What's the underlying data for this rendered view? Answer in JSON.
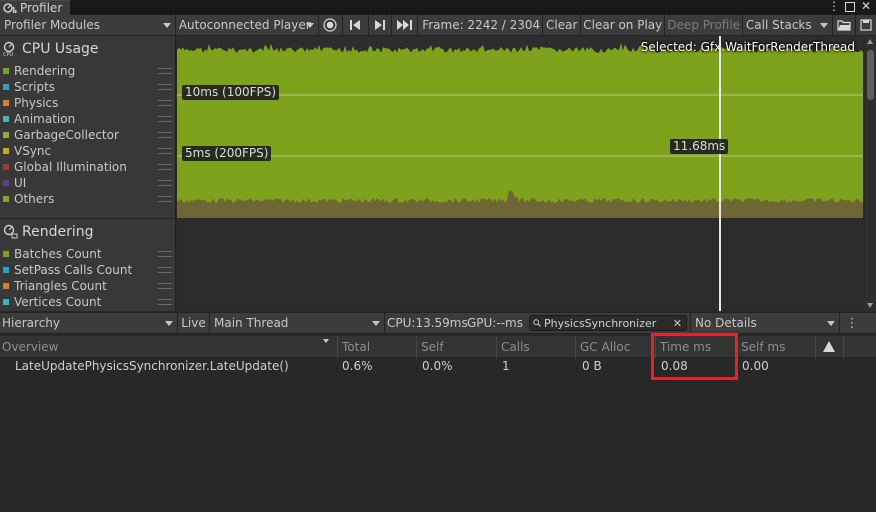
{
  "window": {
    "tab_title": "Profiler"
  },
  "toolbar": {
    "modules_label": "Profiler Modules",
    "target_label": "Autoconnected Player",
    "frame_label": "Frame: 2242 / 2304",
    "clear_label": "Clear",
    "clear_on_play_label": "Clear on Play",
    "deep_profile_label": "Deep Profile",
    "call_stacks_label": "Call Stacks"
  },
  "modules": {
    "cpu": {
      "title": "CPU Usage",
      "legend": [
        {
          "label": "Rendering",
          "color": "#78a31c"
        },
        {
          "label": "Scripts",
          "color": "#2aa3c6"
        },
        {
          "label": "Physics",
          "color": "#d8812a"
        },
        {
          "label": "Animation",
          "color": "#35b7c6"
        },
        {
          "label": "GarbageCollector",
          "color": "#9ba634"
        },
        {
          "label": "VSync",
          "color": "#c9a41f"
        },
        {
          "label": "Global Illumination",
          "color": "#a53a2a"
        },
        {
          "label": "UI",
          "color": "#5a3f8f"
        },
        {
          "label": "Others",
          "color": "#83a52a"
        }
      ]
    },
    "rendering": {
      "title": "Rendering",
      "legend": [
        {
          "label": "Batches Count",
          "color": "#78a31c"
        },
        {
          "label": "SetPass Calls Count",
          "color": "#2aa3c6"
        },
        {
          "label": "Triangles Count",
          "color": "#d8812a"
        },
        {
          "label": "Vertices Count",
          "color": "#35b7c6"
        }
      ]
    }
  },
  "chart": {
    "selected_label": "Selected: Gfx.WaitForRenderThread",
    "line_10ms": "10ms (100FPS)",
    "line_5ms": "5ms (200FPS)",
    "cursor_value": "11.68ms",
    "fill_color": "#7ea21b"
  },
  "details": {
    "view_label": "Hierarchy",
    "live_label": "Live",
    "thread_label": "Main Thread",
    "cpu_label": "CPU:13.59ms",
    "gpu_label": "GPU:--ms",
    "search_value": "PhysicsSynchronizer",
    "no_details_label": "No Details"
  },
  "table": {
    "columns": [
      "Overview",
      "Total",
      "Self",
      "Calls",
      "GC Alloc",
      "Time ms",
      "Self ms"
    ],
    "rows": [
      {
        "name": "LateUpdatePhysicsSynchronizer.LateUpdate()",
        "total": "0.6%",
        "self": "0.0%",
        "calls": "1",
        "gc_alloc": "0 B",
        "time_ms": "0.08",
        "self_ms": "0.00"
      }
    ]
  },
  "colors": {
    "highlight": "#e0242a"
  }
}
